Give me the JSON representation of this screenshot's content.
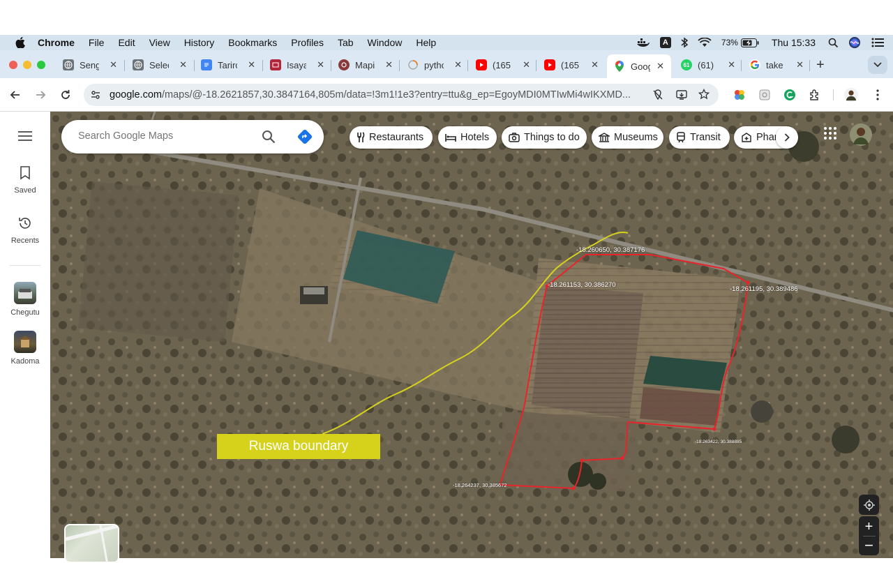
{
  "menubar": {
    "app_name": "Chrome",
    "items": [
      "File",
      "Edit",
      "View",
      "History",
      "Bookmarks",
      "Profiles",
      "Tab",
      "Window",
      "Help"
    ],
    "battery": "73%",
    "clock": "Thu 15:33",
    "input_source": "A"
  },
  "tabs": [
    {
      "title": "Seng",
      "icon": "globe-icon",
      "color": "#5f6368"
    },
    {
      "title": "Selec",
      "icon": "globe-icon",
      "color": "#5f6368"
    },
    {
      "title": "Tarirc",
      "icon": "docs-icon",
      "color": "#4285f4"
    },
    {
      "title": "Isaya",
      "icon": "book-icon",
      "color": "#c0392b"
    },
    {
      "title": "Mapi",
      "icon": "circle-icon",
      "color": "#c0392b"
    },
    {
      "title": "pytho",
      "icon": "loading-icon",
      "color": "#e67e22"
    },
    {
      "title": "(165",
      "icon": "youtube-icon",
      "color": "#ff0000"
    },
    {
      "title": "(165",
      "icon": "youtube-icon",
      "color": "#ff0000"
    },
    {
      "title": "Goog",
      "icon": "maps-icon",
      "color": "#34a853",
      "active": true
    },
    {
      "title": "(61)",
      "icon": "whatsapp-icon",
      "color": "#25d366",
      "badge": "61"
    },
    {
      "title": "take",
      "icon": "google-icon",
      "color": "#4285f4"
    }
  ],
  "address": {
    "host": "google.com",
    "path": "/maps/@-18.2621857,30.3847164,805m/data=!3m1!1e3?entry=ttu&g_ep=EgoyMDI0MTIwMi4wIKXMD..."
  },
  "maps": {
    "search_placeholder": "Search Google Maps",
    "sidebar": {
      "saved": "Saved",
      "recents": "Recents",
      "place1": "Chegutu",
      "place2": "Kadoma"
    },
    "chips": [
      "Restaurants",
      "Hotels",
      "Things to do",
      "Museums",
      "Transit",
      "Phar"
    ],
    "coords": {
      "c1": "-18.260650, 30.387176",
      "c2": "-18.261153, 30.386270",
      "c3": "-18.261195, 30.389486",
      "c4": "-18.263422, 30.388885",
      "c5": "-18.264237, 30.385672"
    },
    "boundary_label": "Ruswa boundary",
    "colors": {
      "boundary_red": "#e8242a",
      "boundary_yellow": "#d6d21c",
      "label_bg": "#d6d21c"
    }
  }
}
